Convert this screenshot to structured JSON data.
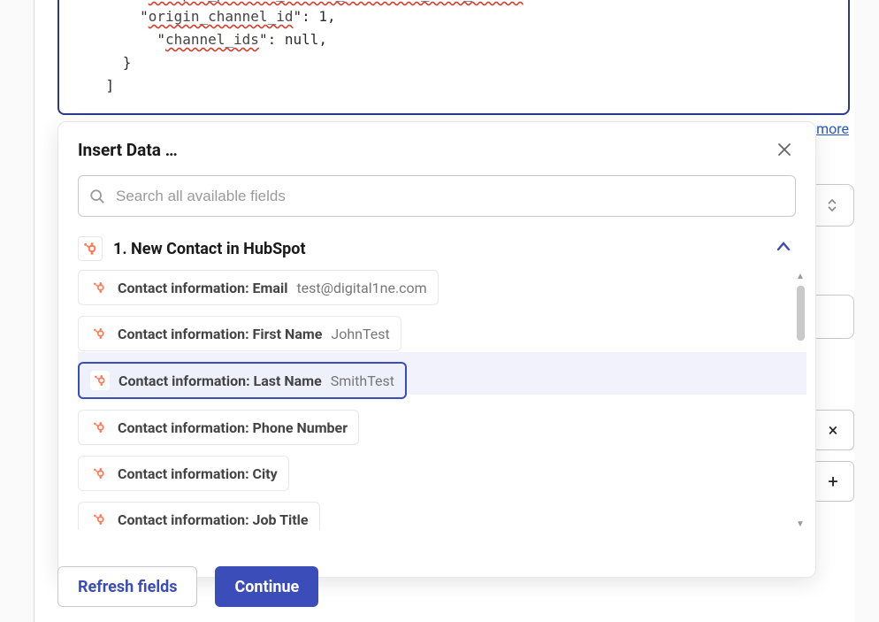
{
  "code_lines": [
    {
      "indent": 4,
      "key": "accepts_product_review_abandoned_cart_emails",
      "val": "true,"
    },
    {
      "indent": 4,
      "key": "origin_channel_id",
      "val": "1,"
    },
    {
      "indent": 5,
      "key": "channel_ids",
      "val": "null,"
    },
    {
      "indent": 3,
      "raw": "}"
    },
    {
      "indent": 2,
      "raw": "]"
    }
  ],
  "more_link": "more",
  "panel": {
    "title": "Insert Data …",
    "search_placeholder": "Search all available fields",
    "group_title": "1. New Contact in HubSpot",
    "items": [
      {
        "label": "Contact information: Email",
        "value": "test@digital1ne.com",
        "selected": false
      },
      {
        "label": "Contact information: First Name",
        "value": "JohnTest",
        "selected": false
      },
      {
        "label": "Contact information: Last Name",
        "value": "SmithTest",
        "selected": true
      },
      {
        "label": "Contact information: Phone Number",
        "value": "",
        "selected": false
      },
      {
        "label": "Contact information: City",
        "value": "",
        "selected": false
      },
      {
        "label": "Contact information: Job Title",
        "value": "",
        "selected": false
      }
    ]
  },
  "buttons": {
    "refresh": "Refresh fields",
    "continue": "Continue"
  },
  "side": {
    "remove": "×",
    "add": "+"
  }
}
